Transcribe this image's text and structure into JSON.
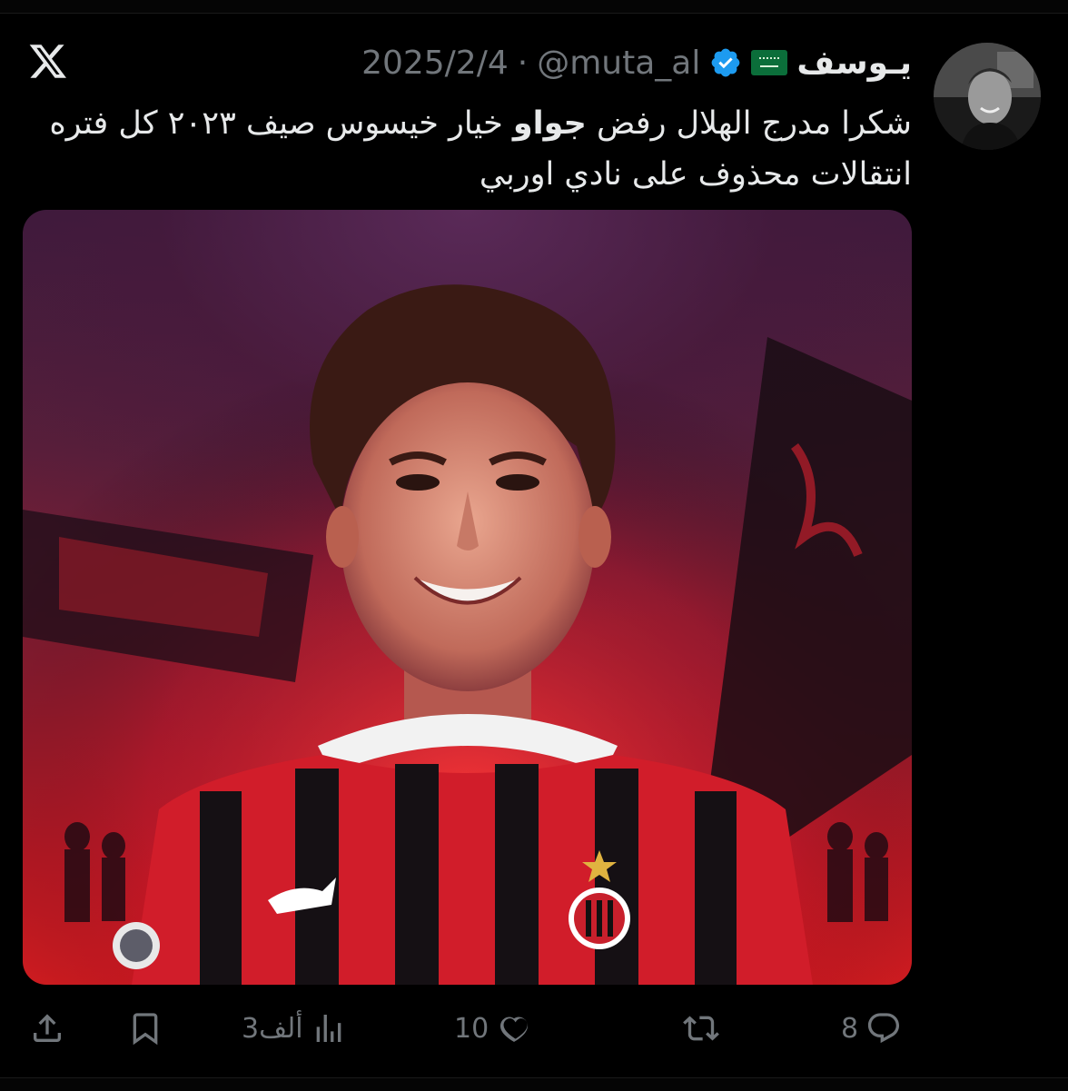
{
  "author": {
    "display_name": "يـوسف",
    "handle": "@muta_al",
    "date": "2025/2/4",
    "separator": "·"
  },
  "tweet": {
    "text_before": "شكرا مدرج الهلال رفض ",
    "text_bold": "جواو",
    "text_after": " خيار خيسوس صيف ٢٠٢٣ كل فتره انتقالات محذوف على نادي اوربي"
  },
  "media": {
    "alt": "Player in red and black striped AC Milan kit"
  },
  "actions": {
    "replies": "8",
    "reposts": "",
    "likes": "10",
    "views": "3ألف"
  },
  "colors": {
    "background": "#000000",
    "text": "#e7e9ea",
    "muted": "#71767b",
    "verified": "#1d9bf0",
    "flag_green": "#0b6e3a"
  },
  "icons": [
    "x-logo-icon",
    "saudi-flag-icon",
    "verified-badge-icon",
    "reply-icon",
    "repost-icon",
    "like-icon",
    "views-icon",
    "bookmark-icon",
    "share-icon"
  ]
}
